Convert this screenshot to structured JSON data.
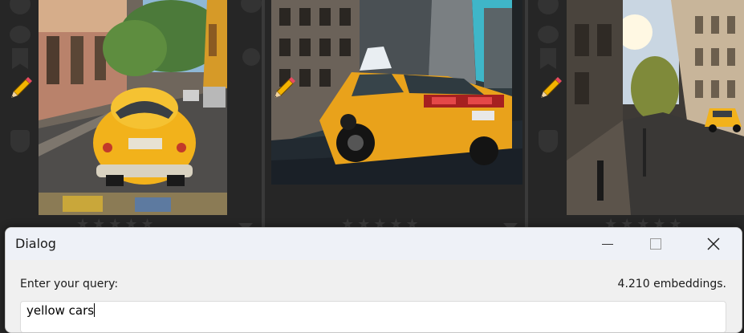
{
  "background": {
    "thumbnails": [
      {
        "name": "havana-yellow-classic-car",
        "rating_stars": "★★★★★"
      },
      {
        "name": "new-york-yellow-taxi",
        "rating_stars": "★★★★★"
      },
      {
        "name": "paris-street-yellow-taxi",
        "rating_stars": "★★★★★"
      }
    ],
    "icons": [
      "pencil-icon",
      "bookmark-icon",
      "search-icon",
      "shield-icon",
      "dropdown-triangle-icon"
    ]
  },
  "dialog": {
    "title": "Dialog",
    "window_controls": [
      "minimize",
      "maximize",
      "close"
    ],
    "prompt_label": "Enter your query:",
    "embeddings_count": "4.210 embeddings.",
    "query_value": "yellow cars"
  },
  "colors": {
    "taxi_yellow": "#f2b21b",
    "pencil_yellow": "#f4b400",
    "dialog_bg": "#f0f0f0",
    "titlebar_bg": "#eef1f7"
  }
}
